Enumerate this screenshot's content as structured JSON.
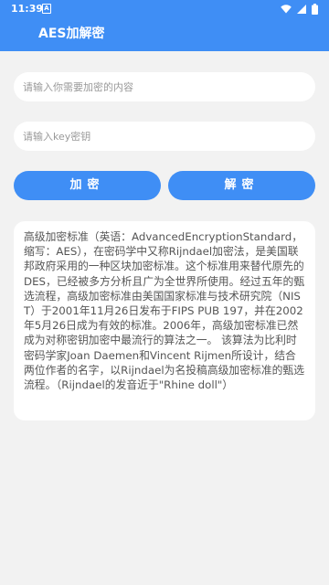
{
  "status_bar": {
    "time": "11:39",
    "notification_glyph": "A",
    "icons": [
      "wifi-icon",
      "signal-icon",
      "battery-icon"
    ]
  },
  "app_bar": {
    "title": "AES加解密"
  },
  "inputs": {
    "content_placeholder": "请输入你需要加密的内容",
    "key_placeholder": "请输入key密钥"
  },
  "buttons": {
    "encrypt_label": "加密",
    "decrypt_label": "解密"
  },
  "info_card": {
    "text": "高级加密标准（英语：AdvancedEncryptionStandard，缩写：AES），在密码学中又称Rijndael加密法，是美国联邦政府采用的一种区块加密标准。这个标准用来替代原先的DES，已经被多方分析且广为全世界所使用。经过五年的甄选流程，高级加密标准由美国国家标准与技术研究院（NIST）于2001年11月26日发布于FIPS PUB 197，并在2002年5月26日成为有效的标准。2006年，高级加密标准已然成为对称密钥加密中最流行的算法之一。 该算法为比利时密码学家Joan Daemen和Vincent Rijmen所设计，结合两位作者的名字，以Rijndael为名投稿高级加密标准的甄选流程。（Rijndael的发音近于\"Rhine doll\"）"
  },
  "colors": {
    "accent": "#3f8ef5",
    "background": "#f2f2f2",
    "surface": "#ffffff"
  }
}
